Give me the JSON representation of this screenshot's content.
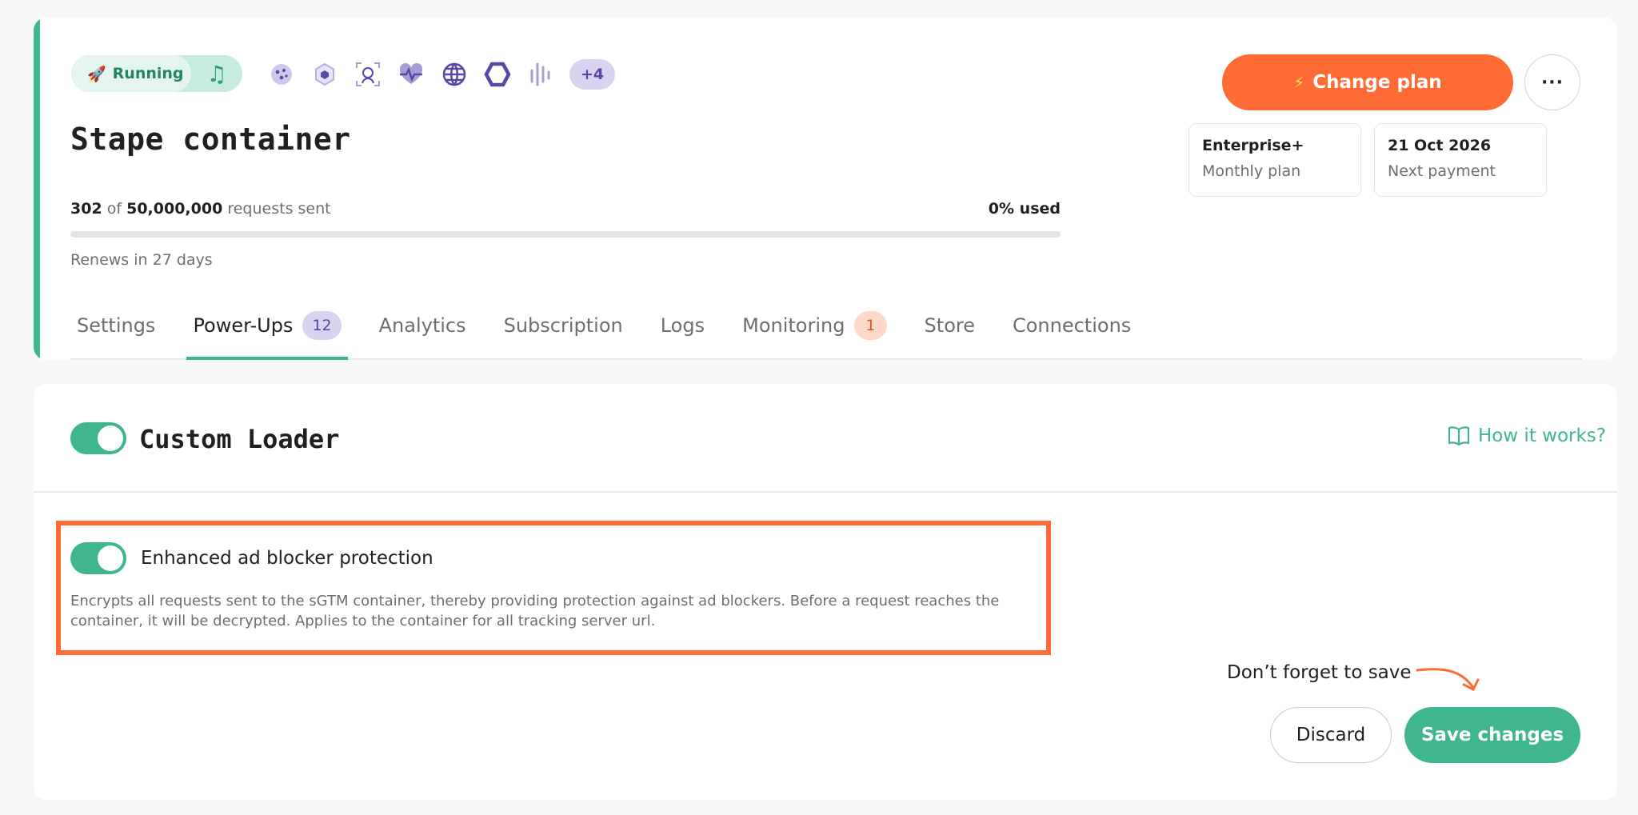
{
  "container": {
    "status": "Running",
    "status_icon": "rocket-icon",
    "title": "Stape container",
    "more_powerups": "+4",
    "usage": {
      "used": "302",
      "of_word": "of",
      "limit": "50,000,000",
      "suffix": "requests sent",
      "percent_text": "0% used",
      "percent_value": 0
    },
    "renews": "Renews in 27 days"
  },
  "plan": {
    "change_label": "Change plan",
    "name": "Enterprise+",
    "cycle": "Monthly plan",
    "next_date": "21 Oct 2026",
    "next_label": "Next payment"
  },
  "tabs": [
    {
      "label": "Settings"
    },
    {
      "label": "Power-Ups",
      "count": "12"
    },
    {
      "label": "Analytics"
    },
    {
      "label": "Subscription"
    },
    {
      "label": "Logs"
    },
    {
      "label": "Monitoring",
      "count": "1"
    },
    {
      "label": "Store"
    },
    {
      "label": "Connections"
    }
  ],
  "loader": {
    "title": "Custom Loader",
    "help_link": "How it works?",
    "option_title": "Enhanced ad blocker protection",
    "option_desc": "Encrypts all requests sent to the sGTM container, thereby providing protection against ad blockers. Before a request reaches the container, it will be decrypted. Applies to the container for all tracking server url.",
    "reminder": "Don’t forget to save",
    "discard": "Discard",
    "save": "Save changes"
  },
  "colors": {
    "accent": "#3fb68b",
    "brand": "#ff6b35",
    "purple": "#5a46a6"
  }
}
